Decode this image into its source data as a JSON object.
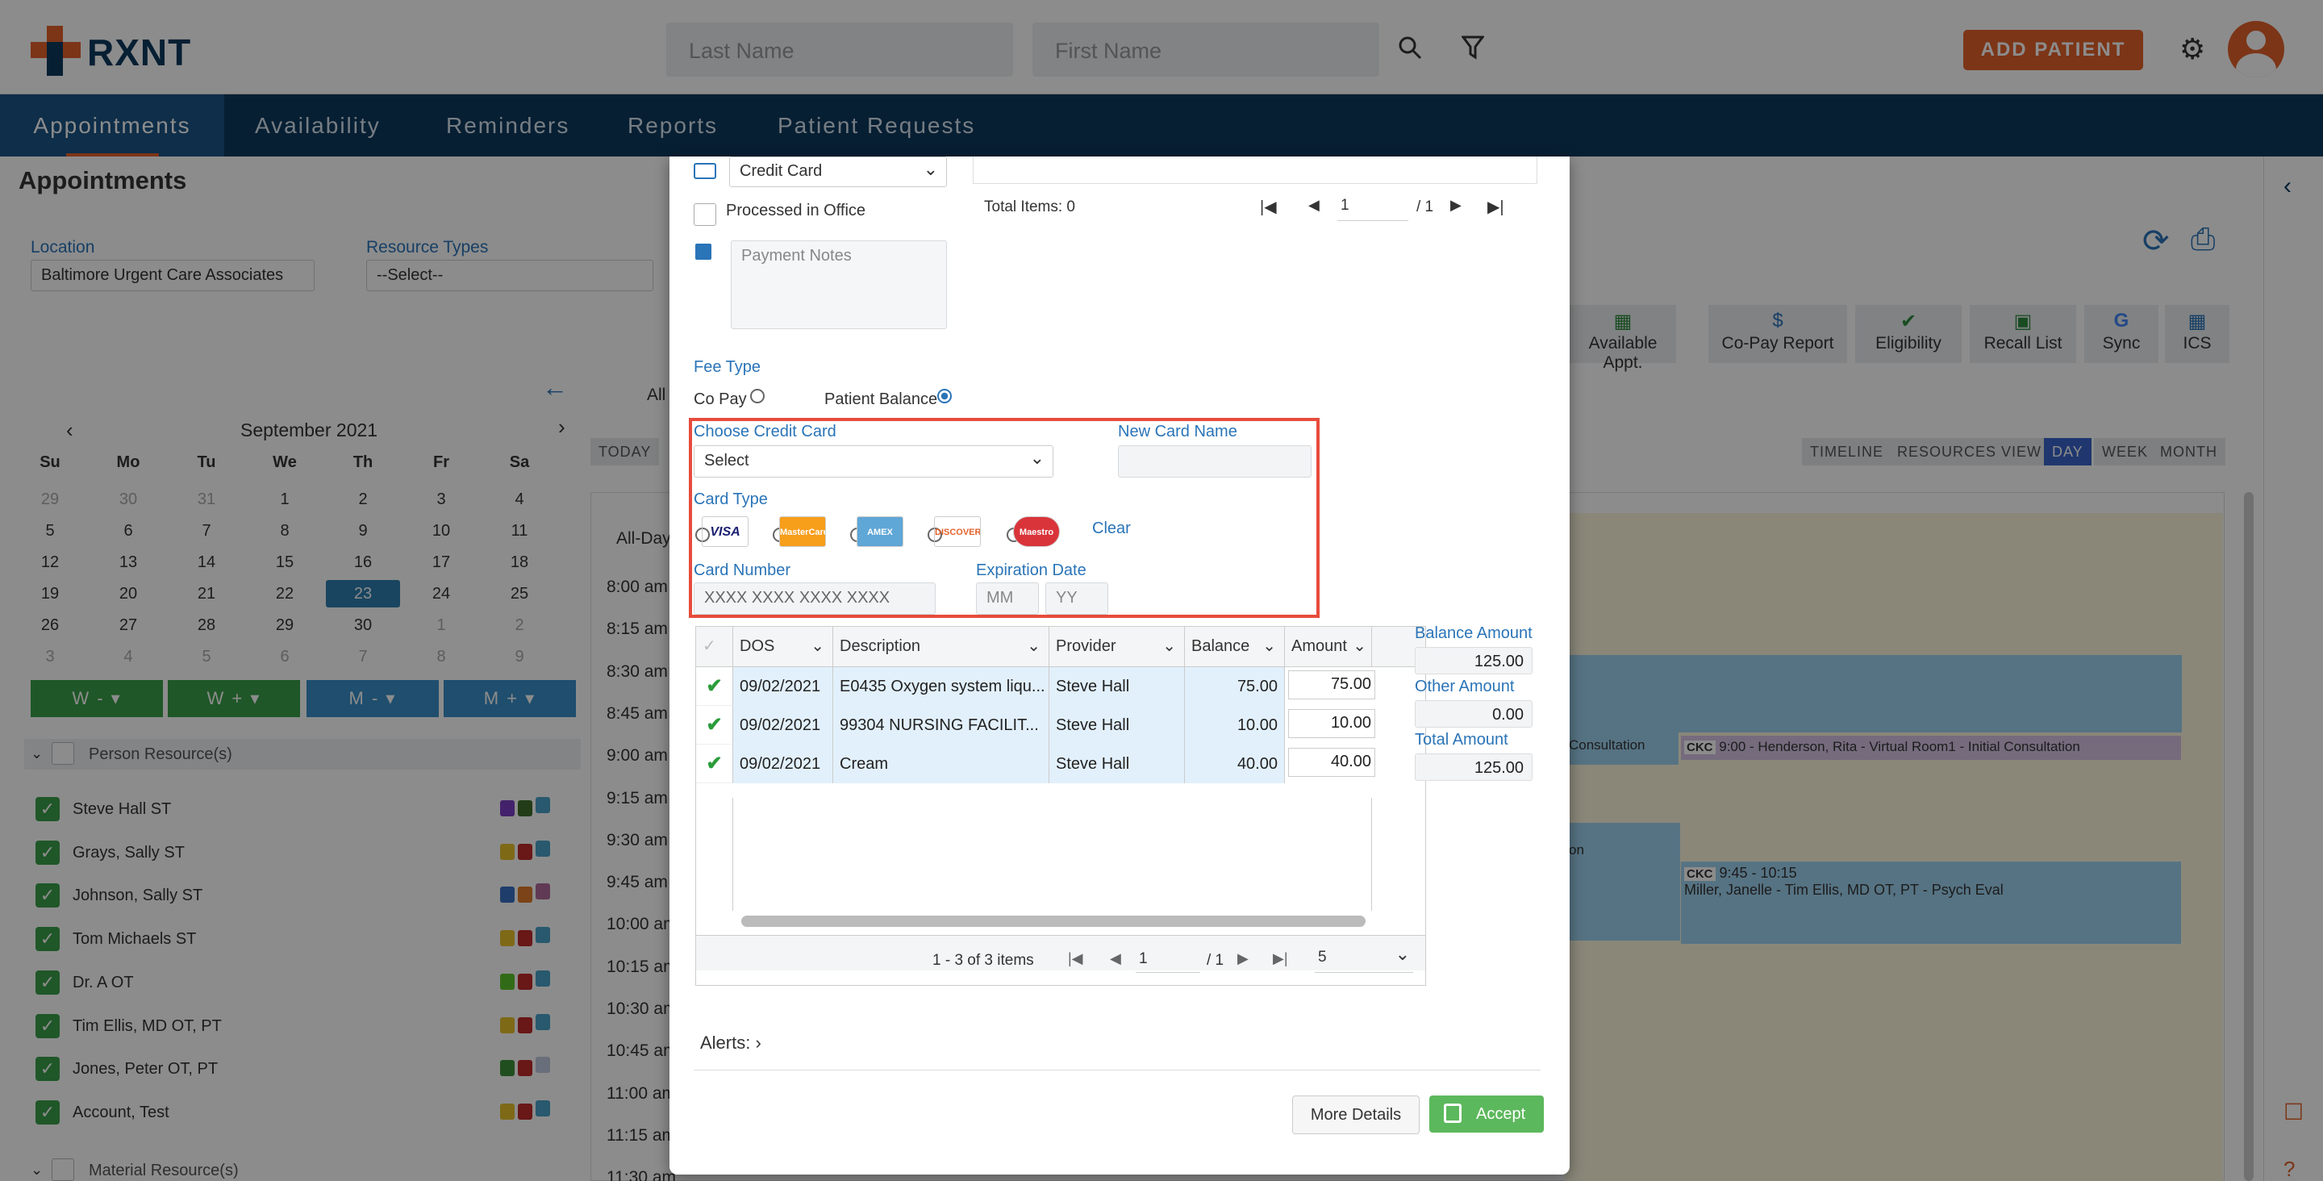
{
  "header": {
    "logo_text": "RXNT",
    "last_name_placeholder": "Last Name",
    "first_name_placeholder": "First Name",
    "add_patient_label": "ADD PATIENT"
  },
  "nav": {
    "tabs": [
      {
        "label": "Appointments"
      },
      {
        "label": "Availability"
      },
      {
        "label": "Reminders"
      },
      {
        "label": "Reports"
      },
      {
        "label": "Patient Requests"
      }
    ]
  },
  "page": {
    "title": "Appointments",
    "location_label": "Location",
    "location_value": "Baltimore Urgent Care Associates",
    "resource_types_label": "Resource Types",
    "resource_types_value": "--Select--",
    "all_label": "All",
    "today_label": "TODAY",
    "allday_label": "All-Day"
  },
  "calendar": {
    "month": "September 2021",
    "weekdays": [
      "Su",
      "Mo",
      "Tu",
      "We",
      "Th",
      "Fr",
      "Sa"
    ],
    "weeks": [
      [
        "29",
        "30",
        "31",
        "1",
        "2",
        "3",
        "4"
      ],
      [
        "5",
        "6",
        "7",
        "8",
        "9",
        "10",
        "11"
      ],
      [
        "12",
        "13",
        "14",
        "15",
        "16",
        "17",
        "18"
      ],
      [
        "19",
        "20",
        "21",
        "22",
        "23",
        "24",
        "25"
      ],
      [
        "26",
        "27",
        "28",
        "29",
        "30",
        "1",
        "2"
      ],
      [
        "3",
        "4",
        "5",
        "6",
        "7",
        "8",
        "9"
      ]
    ],
    "selected": "23",
    "week_buttons": [
      "W - ▾",
      "W + ▾",
      "M - ▾",
      "M + ▾"
    ]
  },
  "resources": {
    "person_header": "Person Resource(s)",
    "people": [
      "Steve Hall ST",
      "Grays, Sally ST",
      "Johnson, Sally ST",
      "Tom Michaels ST",
      "Dr. A OT",
      "Tim Ellis, MD OT, PT",
      "Jones, Peter OT, PT",
      "Account, Test"
    ],
    "material_header": "Material Resource(s)"
  },
  "times": [
    "8:00 am",
    "8:15 am",
    "8:30 am",
    "8:45 am",
    "9:00 am",
    "9:15 am",
    "9:30 am",
    "9:45 am",
    "10:00 am",
    "10:15 am",
    "10:30 am",
    "10:45 am",
    "11:00 am",
    "11:15 am",
    "11:30 am"
  ],
  "toolbar": {
    "items": [
      "Available Appt.",
      "Co-Pay Report",
      "Eligibility",
      "Recall List",
      "Sync",
      "ICS"
    ],
    "views": [
      "TIMELINE",
      "RESOURCES VIEW",
      "DAY",
      "WEEK",
      "MONTH"
    ]
  },
  "events": {
    "e1_tag": "CKC",
    "e1_text": "9:00 - Henderson, Rita - Virtual Room1 - Initial Consultation",
    "e1_left_text": "Consultation",
    "e2_tag": "CKC",
    "e2_time": "9:45 - 10:15",
    "e2_text": "Miller, Janelle - Tim Ellis, MD OT, PT - Psych Eval",
    "e2_left_text": "on"
  },
  "modal": {
    "payment_method": "Credit Card",
    "processed_label": "Processed in Office",
    "total_items": "Total Items: 0",
    "page_value": "1",
    "page_total": "/ 1",
    "notes_placeholder": "Payment Notes",
    "fee_type_label": "Fee Type",
    "copay_label": "Co Pay",
    "patient_balance_label": "Patient Balance",
    "choose_card_label": "Choose Credit Card",
    "choose_card_value": "Select",
    "new_card_label": "New Card Name",
    "card_type_label": "Card Type",
    "cards": [
      "VISA",
      "MasterCard",
      "AMEX",
      "DISCOVER",
      "Maestro"
    ],
    "clear_label": "Clear",
    "card_number_label": "Card Number",
    "card_number_placeholder": "XXXX XXXX XXXX XXXX",
    "expiration_label": "Expiration Date",
    "mm_placeholder": "MM",
    "yy_placeholder": "YY",
    "grid": {
      "headers": [
        "DOS",
        "Description",
        "Provider",
        "Balance",
        "Amount"
      ],
      "rows": [
        {
          "dos": "09/02/2021",
          "desc": "E0435 Oxygen system liqu...",
          "provider": "Steve Hall",
          "balance": "75.00",
          "amount": "75.00"
        },
        {
          "dos": "09/02/2021",
          "desc": "99304 NURSING FACILIT...",
          "provider": "Steve Hall",
          "balance": "10.00",
          "amount": "10.00"
        },
        {
          "dos": "09/02/2021",
          "desc": "Cream",
          "provider": "Steve Hall",
          "balance": "40.00",
          "amount": "40.00"
        }
      ],
      "pager_text": "1 - 3 of 3 items",
      "pager_page": "1",
      "pager_total": "/ 1",
      "page_size": "5"
    },
    "balance_amount_label": "Balance Amount",
    "balance_amount": "125.00",
    "other_amount_label": "Other Amount",
    "other_amount": "0.00",
    "total_amount_label": "Total Amount",
    "total_amount": "125.00",
    "alerts_label": "Alerts:",
    "more_details_label": "More Details",
    "accept_label": "Accept"
  },
  "colors": {
    "accent": "#e2622b",
    "nav": "#0e3a5e",
    "link": "#2a74b8",
    "highlight": "#e74c3c",
    "accept": "#5cb85c"
  }
}
